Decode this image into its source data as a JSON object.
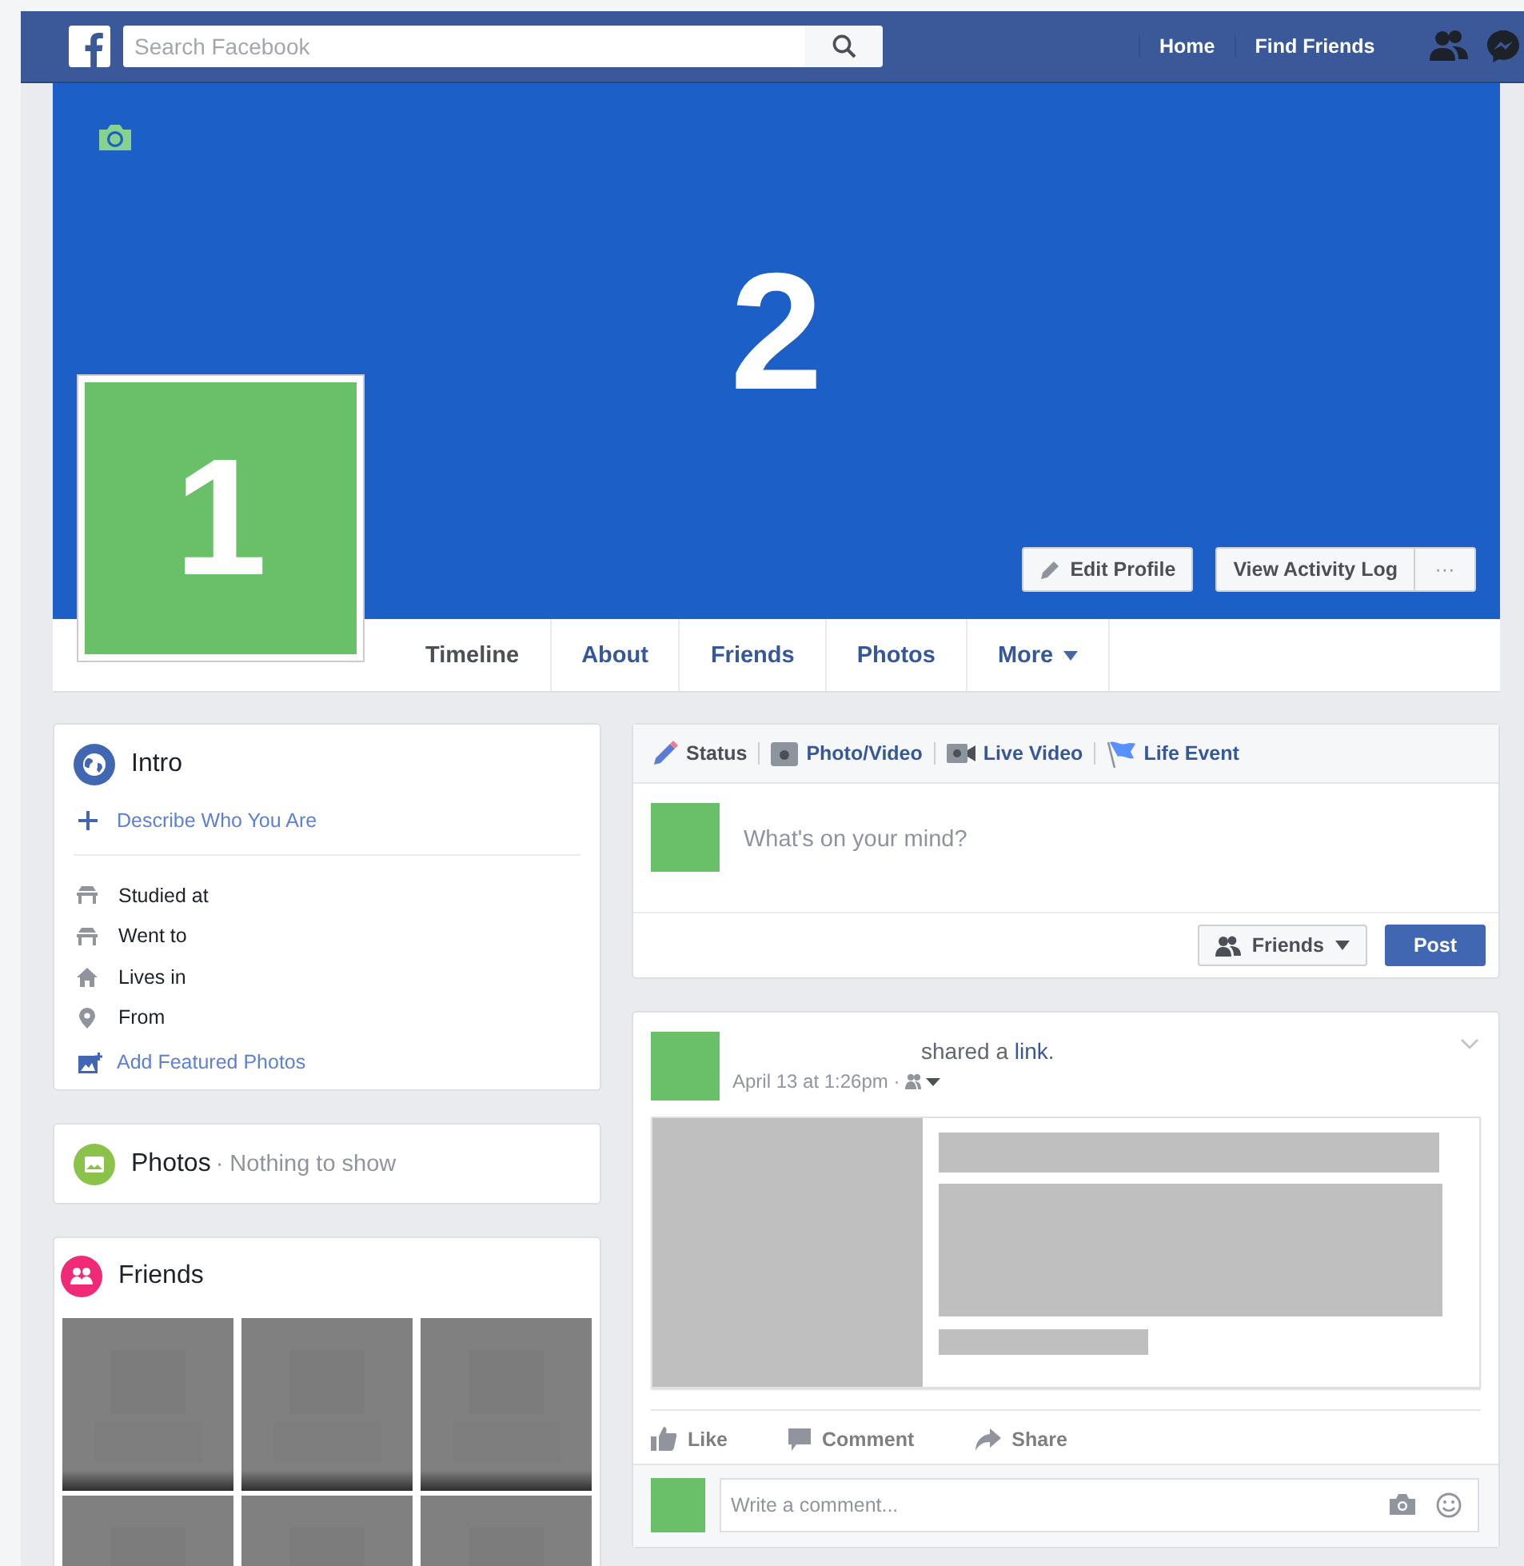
{
  "topbar": {
    "search": {
      "placeholder": "Search Facebook"
    },
    "nav": [
      "Home",
      "Find Friends"
    ]
  },
  "cover": {
    "numeral": "2",
    "profile_numeral": "1",
    "buttons": [
      {
        "kind": "edit",
        "label": "Edit Profile"
      },
      {
        "kind": "log",
        "label": "View Activity Log"
      },
      {
        "kind": "more",
        "label": "···"
      }
    ]
  },
  "tabs": [
    {
      "label": "Timeline",
      "selected": true,
      "dropdown": false
    },
    {
      "label": "About",
      "selected": false,
      "dropdown": false
    },
    {
      "label": "Friends",
      "selected": false,
      "dropdown": false
    },
    {
      "label": "Photos",
      "selected": false,
      "dropdown": false
    },
    {
      "label": "More",
      "selected": false,
      "dropdown": true
    }
  ],
  "intro": {
    "title": "Intro",
    "describe_link": "Describe Who You Are",
    "items": [
      {
        "kind": "school",
        "label": "Studied at"
      },
      {
        "kind": "school",
        "label": "Went to"
      },
      {
        "kind": "home",
        "label": "Lives in"
      },
      {
        "kind": "pin",
        "label": "From"
      }
    ],
    "featured_link": "Add Featured Photos"
  },
  "photos": {
    "title": "Photos",
    "note": "· Nothing to show"
  },
  "friends": {
    "title": "Friends"
  },
  "composer": {
    "tabs": [
      {
        "kind": "pencil",
        "label": "Status",
        "selected": true
      },
      {
        "kind": "camera",
        "label": "Photo/Video",
        "selected": false
      },
      {
        "kind": "video",
        "label": "Live Video",
        "selected": false
      },
      {
        "kind": "flag",
        "label": "Life Event",
        "selected": false
      }
    ],
    "placeholder": "What's on your mind?",
    "audience": "Friends",
    "post_button": "Post"
  },
  "post": {
    "text": "shared a ",
    "link": "link",
    "after": ".",
    "time": "April 13 at 1:26pm ·",
    "actions": [
      {
        "kind": "like",
        "label": "Like"
      },
      {
        "kind": "comment",
        "label": "Comment"
      },
      {
        "kind": "share",
        "label": "Share"
      }
    ],
    "comment_placeholder": "Write a comment..."
  }
}
